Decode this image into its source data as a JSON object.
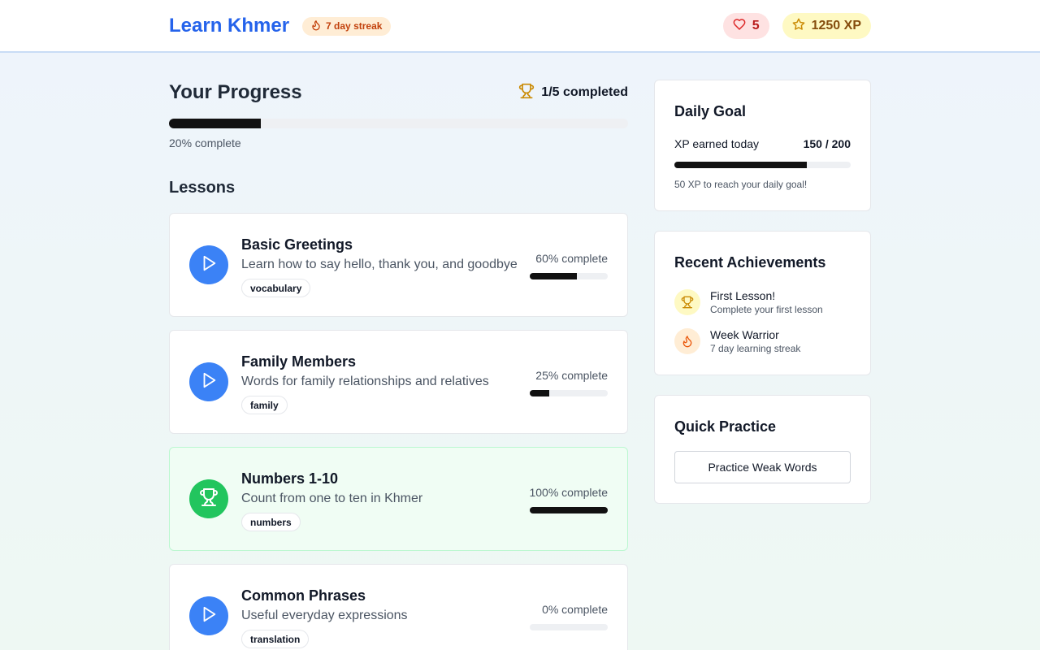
{
  "header": {
    "app_title": "Learn Khmer",
    "streak_label": "7 day streak",
    "hearts": "5",
    "xp": "1250 XP"
  },
  "progress": {
    "title": "Your Progress",
    "completed": "1/5 completed",
    "percent_text": "20% complete",
    "percent_value": 20
  },
  "lessons_title": "Lessons",
  "lessons": [
    {
      "title": "Basic Greetings",
      "description": "Learn how to say hello, thank you, and goodbye",
      "tag": "vocabulary",
      "percent_text": "60% complete",
      "percent_value": 60,
      "status": "in-progress",
      "icon": "play-icon"
    },
    {
      "title": "Family Members",
      "description": "Words for family relationships and relatives",
      "tag": "family",
      "percent_text": "25% complete",
      "percent_value": 25,
      "status": "in-progress",
      "icon": "play-icon"
    },
    {
      "title": "Numbers 1-10",
      "description": "Count from one to ten in Khmer",
      "tag": "numbers",
      "percent_text": "100% complete",
      "percent_value": 100,
      "status": "completed",
      "icon": "trophy-icon"
    },
    {
      "title": "Common Phrases",
      "description": "Useful everyday expressions",
      "tag": "translation",
      "percent_text": "0% complete",
      "percent_value": 0,
      "status": "not-started",
      "icon": "play-icon"
    }
  ],
  "daily_goal": {
    "title": "Daily Goal",
    "label": "XP earned today",
    "value": "150 / 200",
    "percent_value": 75,
    "note": "50 XP to reach your daily goal!"
  },
  "achievements": {
    "title": "Recent Achievements",
    "items": [
      {
        "name": "First Lesson!",
        "description": "Complete your first lesson",
        "icon": "trophy-icon"
      },
      {
        "name": "Week Warrior",
        "description": "7 day learning streak",
        "icon": "flame-icon"
      }
    ]
  },
  "quick_practice": {
    "title": "Quick Practice",
    "button_label": "Practice Weak Words"
  },
  "colors": {
    "brand_blue": "#2563eb",
    "play_blue": "#3b82f6",
    "success_green": "#22c55e",
    "streak_orange": "#c2410c",
    "hearts_red": "#b91c1c",
    "xp_gold": "#854d0e"
  }
}
